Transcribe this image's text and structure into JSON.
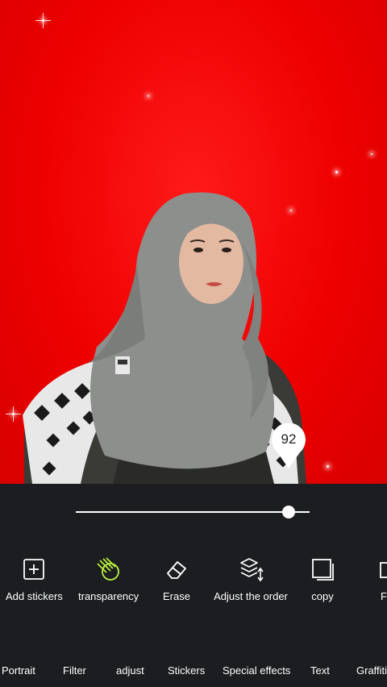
{
  "editor": {
    "transparency_value": "92",
    "transparency_fraction": 0.91
  },
  "tools": [
    {
      "label": "Add stickers",
      "icon": "add-sticker-icon"
    },
    {
      "label": "transparency",
      "icon": "transparency-icon",
      "active_color": "#b9f03b"
    },
    {
      "label": "Erase",
      "icon": "eraser-icon"
    },
    {
      "label": "Adjust the order",
      "icon": "layers-order-icon"
    },
    {
      "label": "copy",
      "icon": "copy-icon"
    },
    {
      "label": "F",
      "icon": "flip-icon"
    }
  ],
  "tabs": [
    {
      "label": "Portrait"
    },
    {
      "label": "Filter"
    },
    {
      "label": "adjust"
    },
    {
      "label": "Stickers"
    },
    {
      "label": "Special effects"
    },
    {
      "label": "Text"
    },
    {
      "label": "Graffiti"
    }
  ],
  "colors": {
    "background_red": "#ee0000",
    "panel": "#1c1d20",
    "accent": "#b9f03b"
  }
}
